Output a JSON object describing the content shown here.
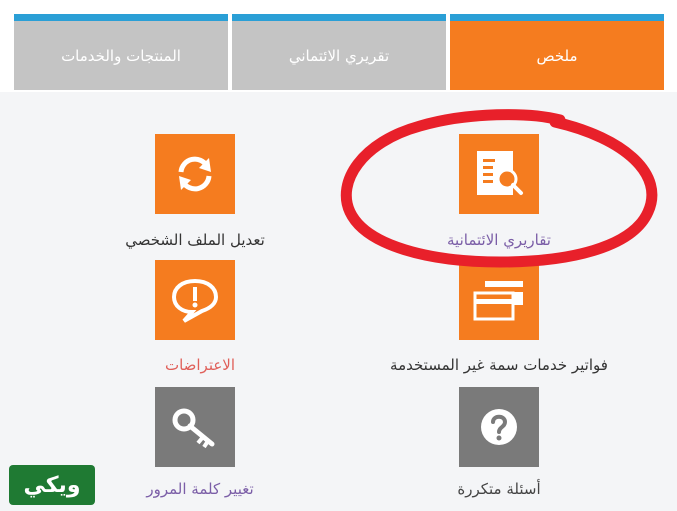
{
  "tabs": [
    {
      "label": "ملخص",
      "active": true
    },
    {
      "label": "تقريري الائتماني",
      "active": false
    },
    {
      "label": "المنتجات والخدمات",
      "active": false
    }
  ],
  "tiles": [
    {
      "label": "تقاريري الائتمانية",
      "icon": "report-search-icon",
      "color": "#7b5ea7"
    },
    {
      "label": "تعديل الملف الشخصي",
      "icon": "refresh-icon",
      "color": "#333333"
    },
    {
      "label": "فواتير خدمات سمة غير المستخدمة",
      "icon": "cards-icon",
      "color": "#333333"
    },
    {
      "label": "الاعتراضات",
      "icon": "speech-alert-icon",
      "color": "#e0605a"
    },
    {
      "label": "أسئلة متكررة",
      "icon": "question-icon",
      "color": "#444444"
    },
    {
      "label": "تغيير كلمة المرور",
      "icon": "key-icon",
      "color": "#7b5ea7"
    }
  ],
  "colors": {
    "accent": "#f57c1f",
    "tab_border": "#2a9fd6",
    "highlight_ring": "#e8202a"
  },
  "logo": {
    "text": "ويكي"
  }
}
